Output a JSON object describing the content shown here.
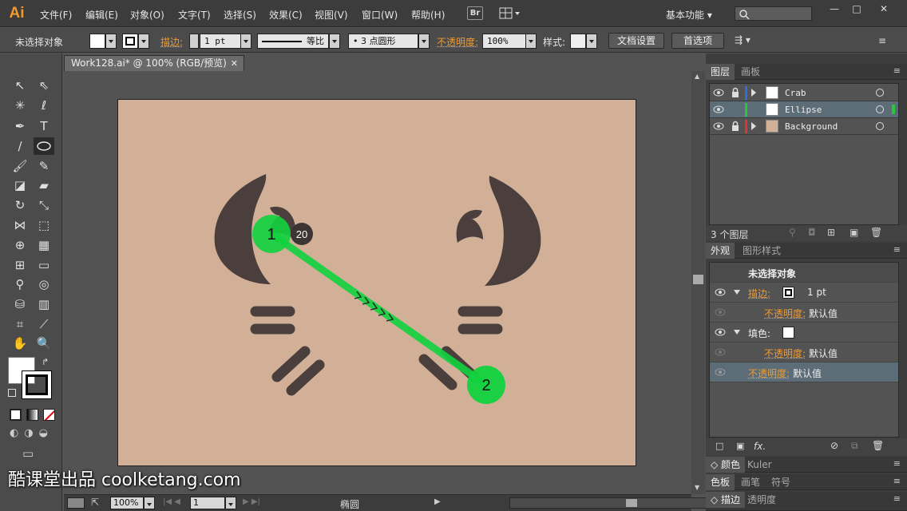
{
  "app": {
    "logo": "Ai"
  },
  "menu": {
    "items": [
      "文件(F)",
      "编辑(E)",
      "对象(O)",
      "文字(T)",
      "选择(S)",
      "效果(C)",
      "视图(V)",
      "窗口(W)",
      "帮助(H)"
    ],
    "bridge": "Br",
    "workspace": "基本功能",
    "window_buttons": [
      "—",
      "□",
      "✕"
    ]
  },
  "control_bar": {
    "selection_label": "未选择对象",
    "stroke_label": "描边:",
    "stroke_weight": "1 pt",
    "stroke_profile": "等比",
    "brush": "3 点圆形",
    "opacity_label": "不透明度:",
    "opacity_value": "100%",
    "style_label": "样式:",
    "doc_setup": "文档设置",
    "preferences": "首选项"
  },
  "document": {
    "tab_title": "Work128.ai* @ 100% (RGB/预览)"
  },
  "canvas": {
    "step_marker_1": "1",
    "step_marker_2": "2",
    "count_badge": "20"
  },
  "status_bar": {
    "zoom": "100%",
    "artboard": "1",
    "tool_name": "椭圆"
  },
  "layers_panel": {
    "tabs": [
      "图层",
      "画板"
    ],
    "layers": [
      {
        "name": "Crab",
        "color": "#2f6ee0",
        "locked": true
      },
      {
        "name": "Ellipse",
        "color": "#28c83c",
        "locked": false,
        "selected": true
      },
      {
        "name": "Background",
        "color": "#e03434",
        "locked": true
      }
    ],
    "footer_count": "3 个图层"
  },
  "appearance_panel": {
    "tabs": [
      "外观",
      "图形样式"
    ],
    "header": "未选择对象",
    "stroke_label": "描边:",
    "stroke_value": "1 pt",
    "opacity_label": "不透明度:",
    "opacity_value": "默认值",
    "fill_label": "填色:",
    "fill_opacity_label": "不透明度:",
    "fill_opacity_value": "默认值",
    "object_opacity_label": "不透明度:",
    "object_opacity_value": "默认值"
  },
  "collapsed_panels": {
    "row1": [
      "颜色",
      "Kuler"
    ],
    "row2": [
      "色板",
      "画笔",
      "符号"
    ],
    "row3": [
      "描边",
      "透明度"
    ]
  },
  "watermark": "酷课堂出品 coolketang.com",
  "colors": {
    "artboard": "#d2b097",
    "shape": "#4a3f3c",
    "accent_green": "#11d33e",
    "ai_orange": "#f29a2c",
    "selected_row": "#5d6d78"
  }
}
